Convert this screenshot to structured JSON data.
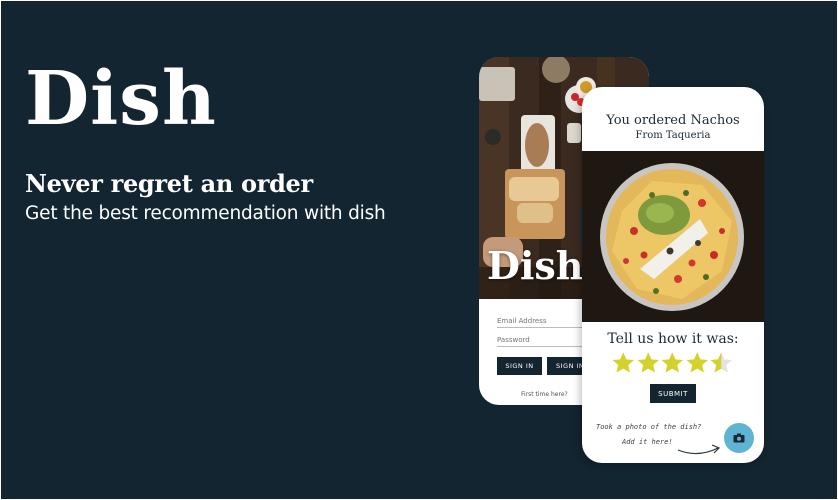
{
  "brand": {
    "name": "Dish",
    "tagline": "Never regret an order",
    "subtitle": "Get the best recommendation with dish"
  },
  "login_screen": {
    "logo": "Dish",
    "email_placeholder": "Email Address",
    "password_placeholder": "Password",
    "button_1": "SIGN IN",
    "button_2": "SIGN IN",
    "first_time": "First time here?"
  },
  "review_screen": {
    "order_title": "You ordered Nachos",
    "restaurant": "From Taqueria",
    "rate_prompt": "Tell us how it was:",
    "rating": 4.5,
    "rating_max": 5,
    "submit_label": "SUBMIT",
    "photo_hint_line1": "Took a photo of the dish?",
    "photo_hint_line2": "Add it here!",
    "fab_icon": "camera-icon"
  },
  "colors": {
    "background": "#132530",
    "star": "#d4d22a",
    "star_empty": "#e3e3e3",
    "button": "#132530",
    "fab": "#5fb3d3"
  }
}
